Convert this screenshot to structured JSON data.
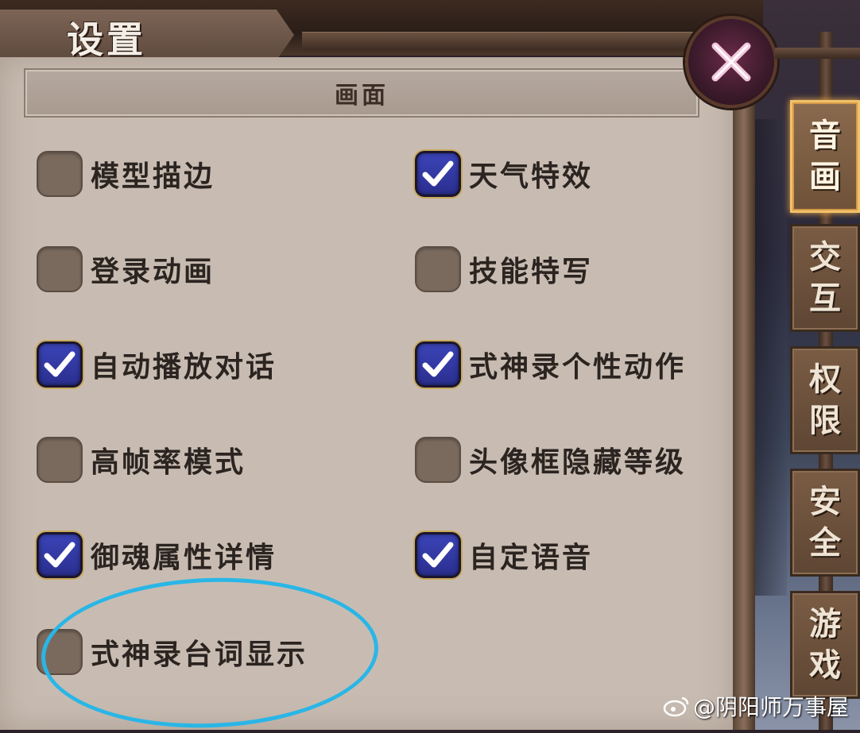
{
  "window": {
    "title": "设置"
  },
  "section": {
    "title": "画面"
  },
  "options": [
    {
      "label": "模型描边",
      "checked": false
    },
    {
      "label": "天气特效",
      "checked": true
    },
    {
      "label": "登录动画",
      "checked": false
    },
    {
      "label": "技能特写",
      "checked": false
    },
    {
      "label": "自动播放对话",
      "checked": true
    },
    {
      "label": "式神录个性动作",
      "checked": true
    },
    {
      "label": "高帧率模式",
      "checked": false
    },
    {
      "label": "头像框隐藏等级",
      "checked": false
    },
    {
      "label": "御魂属性详情",
      "checked": true
    },
    {
      "label": "自定语音",
      "checked": true
    },
    {
      "label": "式神录台词显示",
      "checked": false
    }
  ],
  "tabs": [
    {
      "label": "音画",
      "active": true
    },
    {
      "label": "交互",
      "active": false
    },
    {
      "label": "权限",
      "active": false
    },
    {
      "label": "安全",
      "active": false
    },
    {
      "label": "游戏",
      "active": false
    }
  ],
  "close": {
    "icon": "close-icon"
  },
  "watermark": {
    "text": "@阴阳师万事屋",
    "icon": "weibo-icon"
  },
  "colors": {
    "panel": "#c8bcb2",
    "checked_box": "#2a2f8e",
    "unchecked_box": "#7a6a5e",
    "annotation": "#29b6e6",
    "active_tab_border": "#f2c26a"
  }
}
